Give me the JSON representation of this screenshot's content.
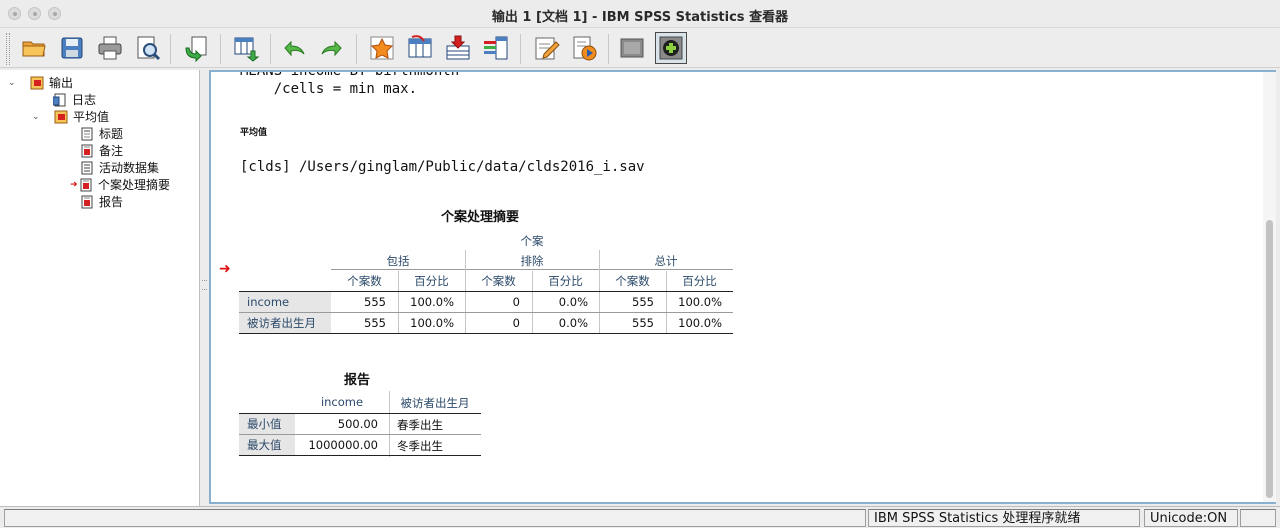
{
  "window": {
    "title": "输出 1 [文档 1] - IBM SPSS Statistics 查看器"
  },
  "toolbar": {
    "buttons": [
      {
        "icon": "open-folder-icon"
      },
      {
        "icon": "save-icon"
      },
      {
        "icon": "print-icon"
      },
      {
        "icon": "print-preview-icon"
      },
      {
        "icon": "export-icon"
      },
      {
        "icon": "goto-data-icon"
      },
      {
        "icon": "undo-icon"
      },
      {
        "icon": "redo-icon"
      },
      {
        "icon": "goto-case-icon"
      },
      {
        "icon": "goto-variable-icon"
      },
      {
        "icon": "insert-cases-icon"
      },
      {
        "icon": "variables-icon"
      },
      {
        "icon": "edit-icon"
      },
      {
        "icon": "run-script-icon"
      },
      {
        "icon": "hide-icon"
      },
      {
        "icon": "designate-window-icon"
      }
    ]
  },
  "tree": {
    "items": [
      {
        "label": "输出"
      },
      {
        "label": "日志"
      },
      {
        "label": "平均值"
      },
      {
        "label": "标题"
      },
      {
        "label": "备注"
      },
      {
        "label": "活动数据集"
      },
      {
        "label": "个案处理摘要"
      },
      {
        "label": "报告"
      }
    ]
  },
  "viewer": {
    "syntax_cut": "MEANS income BY birthmonth",
    "syntax_line": "    /cells = min max.",
    "section_heading": "平均值",
    "dataset_line": "[clds] /Users/ginglam/Public/data/clds2016_i.sav",
    "summary": {
      "title": "个案处理摘要",
      "top_header": "个案",
      "groups": [
        "包括",
        "排除",
        "总计"
      ],
      "subheaders": [
        "个案数",
        "百分比",
        "个案数",
        "百分比",
        "个案数",
        "百分比"
      ],
      "rows": [
        {
          "label": "income",
          "values": [
            "555",
            "100.0%",
            "0",
            "0.0%",
            "555",
            "100.0%"
          ]
        },
        {
          "label": "被访者出生月",
          "values": [
            "555",
            "100.0%",
            "0",
            "0.0%",
            "555",
            "100.0%"
          ]
        }
      ]
    },
    "report": {
      "title": "报告",
      "headers": [
        "income",
        "被访者出生月"
      ],
      "rows": [
        {
          "label": "最小值",
          "values": [
            "500.00",
            "春季出生"
          ]
        },
        {
          "label": "最大值",
          "values": [
            "1000000.00",
            "冬季出生"
          ]
        }
      ]
    }
  },
  "status": {
    "message": "IBM SPSS Statistics 处理程序就绪",
    "encoding": "Unicode:ON"
  },
  "colors": {
    "accent": "#8ab0cf",
    "header_text": "#2c4a6a",
    "marker": "#e01010"
  }
}
